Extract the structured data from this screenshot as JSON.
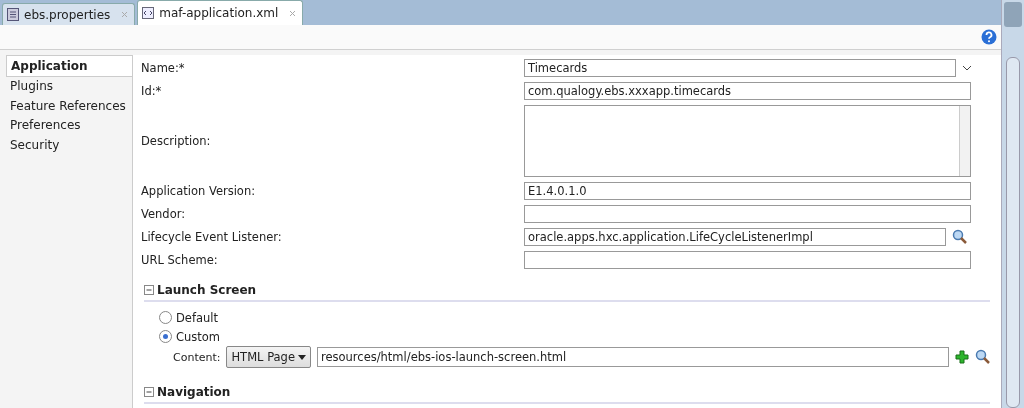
{
  "tabs": [
    {
      "label": "ebs.properties",
      "kind": "properties",
      "selected": false
    },
    {
      "label": "maf-application.xml",
      "kind": "xml",
      "selected": true
    }
  ],
  "sidebar": {
    "items": [
      {
        "label": "Application",
        "selected": true
      },
      {
        "label": "Plugins",
        "selected": false
      },
      {
        "label": "Feature References",
        "selected": false
      },
      {
        "label": "Preferences",
        "selected": false
      },
      {
        "label": "Security",
        "selected": false
      }
    ]
  },
  "fields": [
    {
      "label": "Name:*",
      "value": "Timecards",
      "kind": "combo"
    },
    {
      "label": "Id:*",
      "value": "com.qualogy.ebs.xxxapp.timecards",
      "kind": "text"
    },
    {
      "label": "Description:",
      "kind": "textarea"
    },
    {
      "label": "Application Version:",
      "value": "E1.4.0.1.0",
      "kind": "text"
    },
    {
      "label": "Vendor:",
      "kind": "text"
    },
    {
      "label": "Lifecycle Event Listener:",
      "value": "oracle.apps.hxc.application.LifeCycleListenerImpl",
      "kind": "lookup"
    },
    {
      "label": "URL Scheme:",
      "kind": "text"
    }
  ],
  "launch_screen": {
    "title": "Launch Screen",
    "expanded": true,
    "options": [
      {
        "label": "Default",
        "selected": false
      },
      {
        "label": "Custom",
        "selected": true
      }
    ],
    "content_label": "Content:",
    "content_type": "HTML Page",
    "content_value": "resources/html/ebs-ios-launch-screen.html"
  },
  "navigation": {
    "title": "Navigation",
    "expanded": true
  }
}
